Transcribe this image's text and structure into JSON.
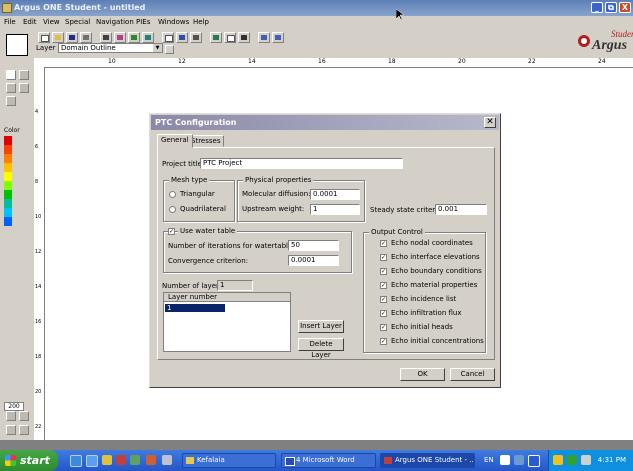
{
  "app": {
    "title": "Argus ONE Student - untitled",
    "window_buttons": [
      "_",
      "⧉",
      "X"
    ]
  },
  "menu": [
    "File",
    "Edit",
    "View",
    "Special",
    "Navigation",
    "PIEs",
    "Windows",
    "Help"
  ],
  "toolbar": {
    "layer_label": "Layer",
    "layer_value": "Domain Outline",
    "logo_top": "Student",
    "logo_main": "Argus"
  },
  "ruler": {
    "h_ticks": [
      "10",
      "12",
      "14",
      "16",
      "18",
      "20",
      "22",
      "24"
    ],
    "v_ticks": [
      "4",
      "6",
      "8",
      "10",
      "12",
      "14",
      "16",
      "18",
      "20",
      "22"
    ]
  },
  "left_panel": {
    "color_label": "Color",
    "zoom_value": "200",
    "palette": [
      "#e00000",
      "#ff4000",
      "#ff8000",
      "#ffc000",
      "#ffff00",
      "#80ff00",
      "#00c000",
      "#00c0a0",
      "#00c0ff",
      "#0060ff"
    ]
  },
  "dialog": {
    "title": "PTC Configuration",
    "tabs": [
      "General",
      "Stresses"
    ],
    "project_title_label": "Project title:",
    "project_title_value": "PTC Project",
    "mesh_type": {
      "title": "Mesh type",
      "options": [
        "Triangular",
        "Quadrilateral"
      ]
    },
    "physical": {
      "title": "Physical properties",
      "molecular_label": "Molecular diffusion:",
      "molecular_value": "0.0001",
      "upstream_label": "Upstream weight:",
      "upstream_value": "1"
    },
    "steady_label": "Steady state criterion:",
    "steady_value": "0.001",
    "water_table": {
      "checkbox_label": "Use water table",
      "iterations_label": "Number of iterations for watertable:",
      "iterations_value": "50",
      "convergence_label": "Convergence criterion:",
      "convergence_value": "0.0001"
    },
    "layers": {
      "count_label": "Number of layers:",
      "count_value": "1",
      "column_header": "Layer number",
      "rows": [
        "1"
      ],
      "insert_button": "Insert Layer",
      "delete_button": "Delete Layer"
    },
    "output": {
      "title": "Output Control",
      "items": [
        "Echo nodal coordinates",
        "Echo interface elevations",
        "Echo boundary conditions",
        "Echo material properties",
        "Echo incidence list",
        "Echo infiltration flux",
        "Echo initial heads",
        "Echo initial concentrations"
      ]
    },
    "ok_button": "OK",
    "cancel_button": "Cancel"
  },
  "taskbar": {
    "start": "start",
    "tasks": [
      "Kefalaia",
      "4 Microsoft Word",
      "Argus ONE Student - ..."
    ],
    "lang": "EN",
    "clock": "4:31 PM"
  }
}
